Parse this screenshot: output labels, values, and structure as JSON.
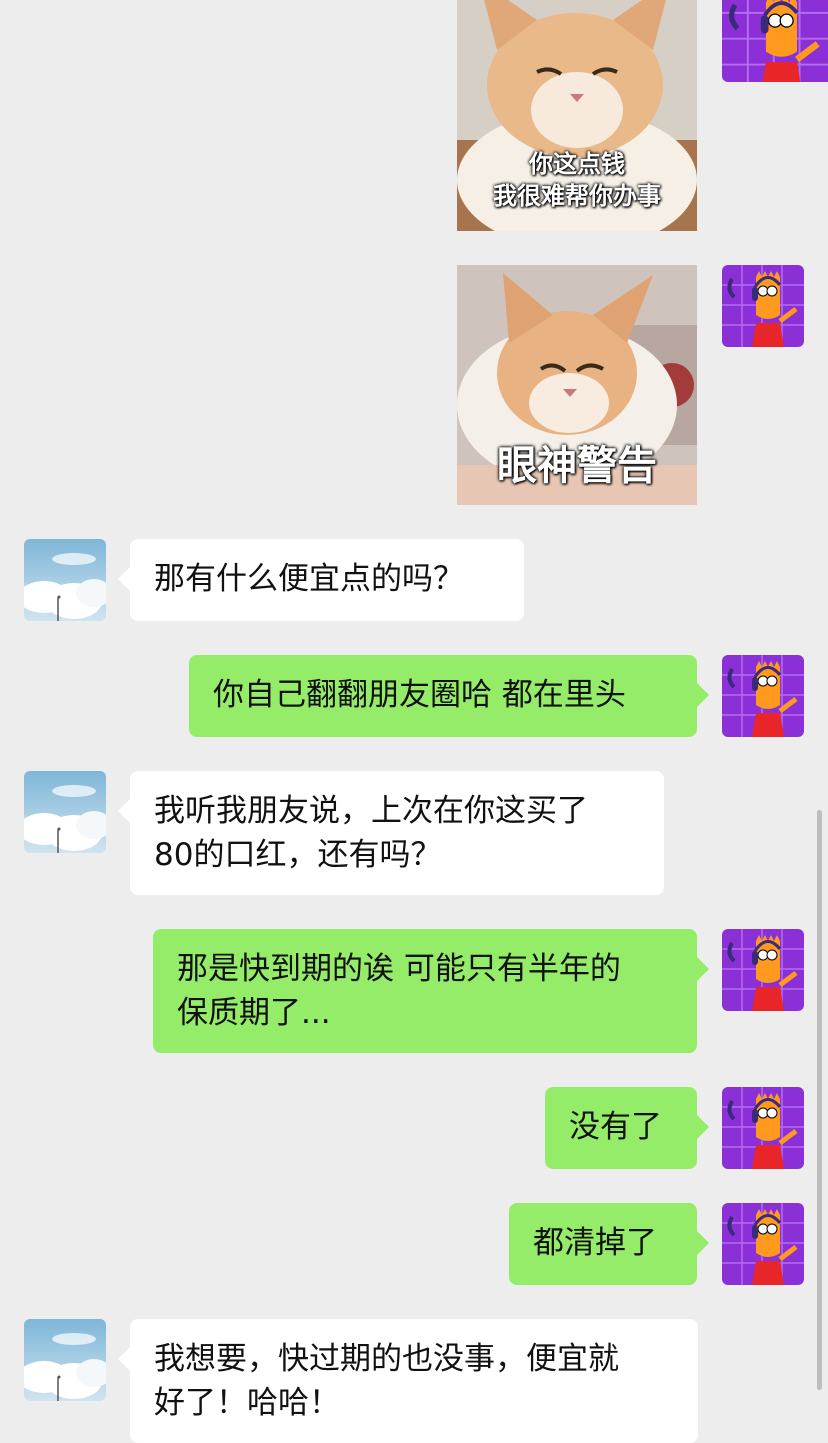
{
  "colors": {
    "background": "#ededed",
    "bubble_self": "#95ec69",
    "bubble_other": "#ffffff",
    "self_avatar_bg": "#8b2fd6",
    "self_avatar_figure": "#ff8c1a"
  },
  "avatars": {
    "self": {
      "icon": "cartoon-boy-headphones-avatar-icon"
    },
    "other": {
      "icon": "sky-clouds-avatar-icon"
    }
  },
  "messages": [
    {
      "id": "m1",
      "sender": "self",
      "type": "sticker",
      "caption": "你这点钱\n我很难帮你办事",
      "icon": "cat-sticker-image"
    },
    {
      "id": "m2",
      "sender": "self",
      "type": "sticker",
      "caption": "眼神警告",
      "icon": "cat-sticker-image"
    },
    {
      "id": "m3",
      "sender": "other",
      "type": "text",
      "text": "那有什么便宜点的吗？"
    },
    {
      "id": "m4",
      "sender": "self",
      "type": "text",
      "text": "你自己翻翻朋友圈哈 都在里头"
    },
    {
      "id": "m5",
      "sender": "other",
      "type": "text",
      "text": "我听我朋友说，上次在你这买了\n80的口红，还有吗？"
    },
    {
      "id": "m6",
      "sender": "self",
      "type": "text",
      "text": "那是快到期的诶 可能只有半年的\n保质期了..."
    },
    {
      "id": "m7",
      "sender": "self",
      "type": "text",
      "text": "没有了"
    },
    {
      "id": "m8",
      "sender": "self",
      "type": "text",
      "text": "都清掉了"
    },
    {
      "id": "m9",
      "sender": "other",
      "type": "text",
      "text": "我想要，快过期的也没事，便宜就\n好了！哈哈！"
    }
  ]
}
